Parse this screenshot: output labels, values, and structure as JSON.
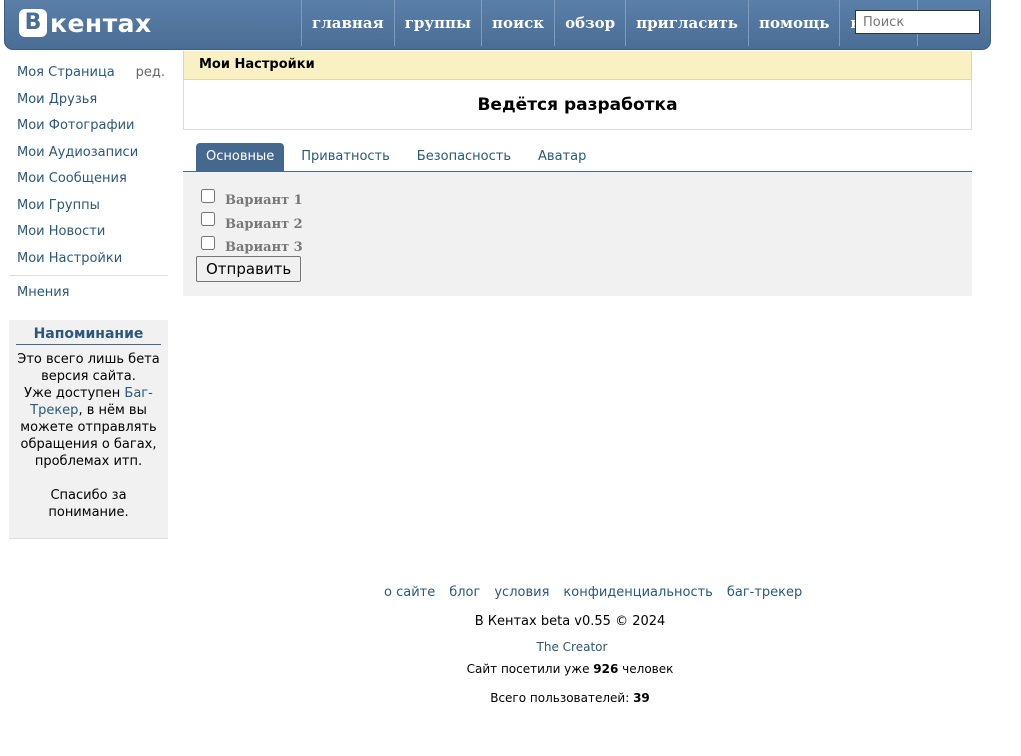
{
  "header": {
    "logo_letter": "В",
    "logo_text": "кентах",
    "nav": [
      "главная",
      "группы",
      "поиск",
      "обзор",
      "пригласить",
      "помощь",
      "выйти"
    ],
    "search_placeholder": "Поиск"
  },
  "sidebar": {
    "items": [
      {
        "label": "Моя Страница",
        "edit": "ред."
      },
      {
        "label": "Мои Друзья"
      },
      {
        "label": "Мои Фотографии"
      },
      {
        "label": "Мои Аудиозаписи"
      },
      {
        "label": "Мои Сообщения"
      },
      {
        "label": "Мои Группы"
      },
      {
        "label": "Мои Новости"
      },
      {
        "label": "Мои Настройки"
      }
    ],
    "extra": "Мнения",
    "reminder": {
      "title": "Напоминание",
      "text1": "Это всего лишь бета версия сайта.",
      "text2a": "Уже доступен ",
      "link": "Баг-Трекер",
      "text2b": ", в нём вы можете отправлять обращения о багах, проблемах итп.",
      "text3": "Спасибо за понимание."
    }
  },
  "main": {
    "page_title": "Мои Настройки",
    "notice": "Ведётся разработка",
    "tabs": [
      "Основные",
      "Приватность",
      "Безопасность",
      "Аватар"
    ],
    "options": [
      "Вариант 1",
      "Вариант 2",
      "Вариант 3"
    ],
    "submit_label": "Отправить"
  },
  "footer": {
    "links": [
      "о сайте",
      "блог",
      "условия",
      "конфиденциальность",
      "баг-трекер"
    ],
    "copyright": "В Кентах beta v0.55 © 2024",
    "creator": "The Creator",
    "visits_prefix": "Сайт посетили уже ",
    "visits_count": "926",
    "visits_suffix": " человек",
    "users_prefix": "Всего пользователей: ",
    "users_count": "39"
  }
}
